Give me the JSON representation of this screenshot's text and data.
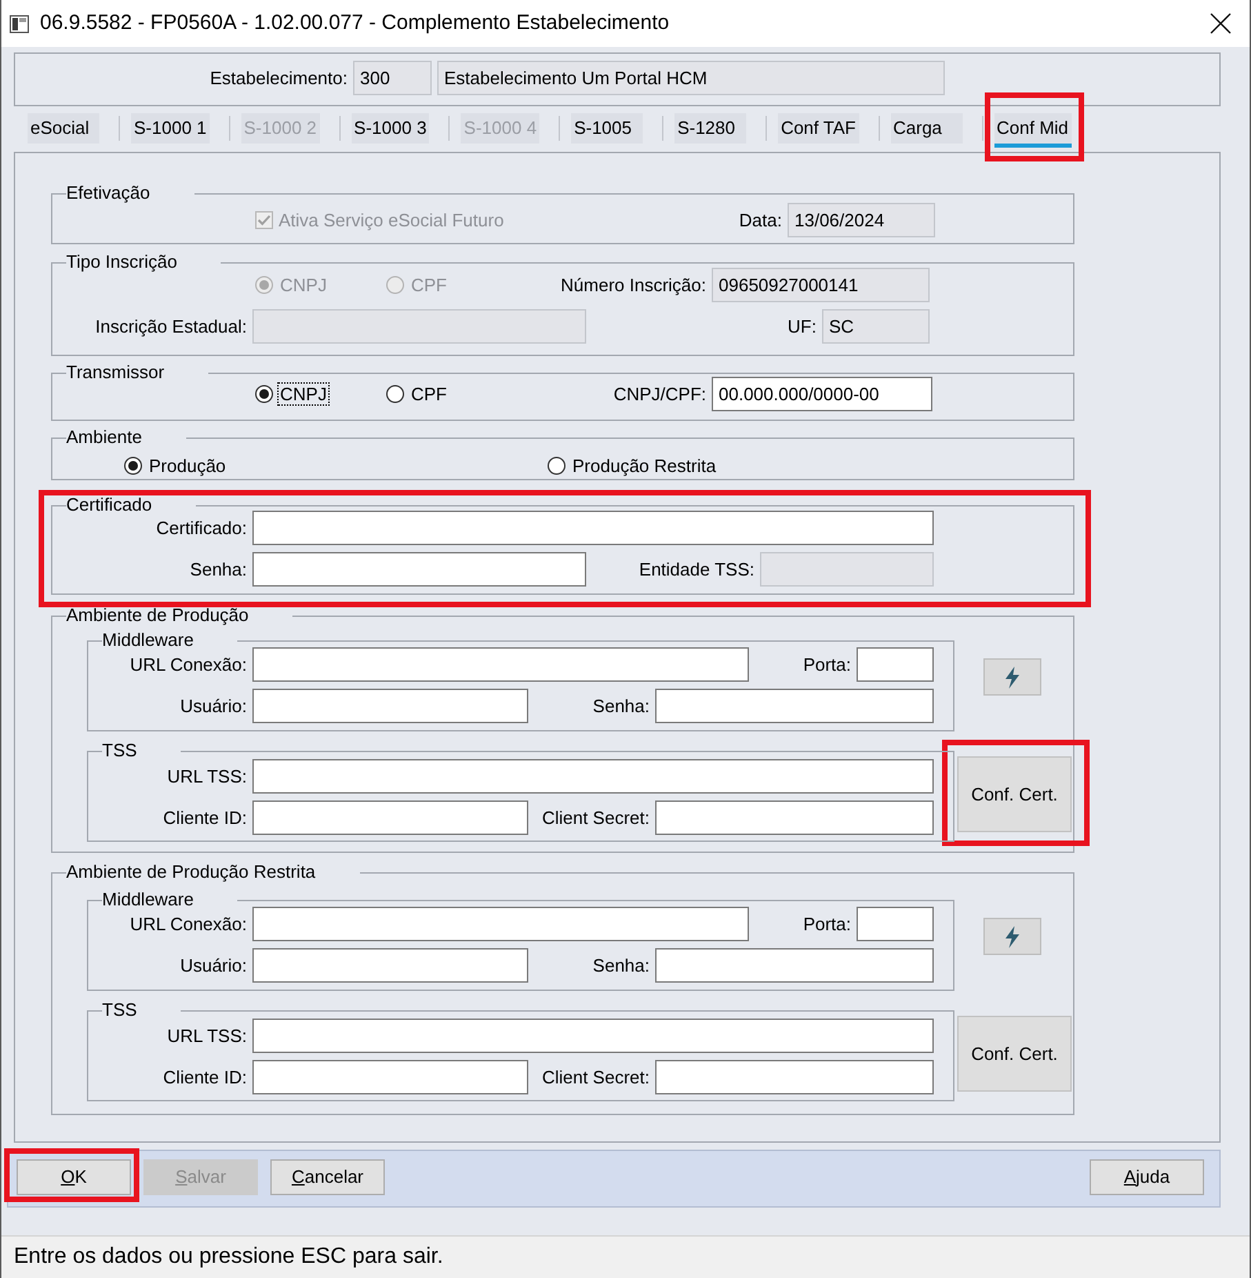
{
  "window": {
    "title": "06.9.5582 - FP0560A - 1.02.00.077 - Complemento Estabelecimento"
  },
  "header": {
    "label": "Estabelecimento:",
    "code": "300",
    "name": "Estabelecimento Um Portal HCM"
  },
  "tabs": [
    {
      "label": "eSocial",
      "selected": false,
      "disabled": false,
      "highlighted": false
    },
    {
      "label": "S-1000 1",
      "selected": false,
      "disabled": false,
      "highlighted": false
    },
    {
      "label": "S-1000 2",
      "selected": false,
      "disabled": true,
      "highlighted": false
    },
    {
      "label": "S-1000 3",
      "selected": false,
      "disabled": false,
      "highlighted": false
    },
    {
      "label": "S-1000 4",
      "selected": false,
      "disabled": true,
      "highlighted": false
    },
    {
      "label": "S-1005",
      "selected": false,
      "disabled": false,
      "highlighted": false
    },
    {
      "label": "S-1280",
      "selected": false,
      "disabled": false,
      "highlighted": false
    },
    {
      "label": "Conf TAF",
      "selected": false,
      "disabled": false,
      "highlighted": false
    },
    {
      "label": "Carga",
      "selected": false,
      "disabled": false,
      "highlighted": false
    },
    {
      "label": "Conf Mid",
      "selected": true,
      "disabled": false,
      "highlighted": true
    }
  ],
  "efetivacao": {
    "title": "Efetivação",
    "checkbox": {
      "label": "Ativa Serviço eSocial Futuro",
      "checked": true,
      "disabled": true
    },
    "date": {
      "label": "Data:",
      "value": "13/06/2024",
      "disabled": true
    }
  },
  "tipo_inscricao": {
    "title": "Tipo Inscrição",
    "options": [
      {
        "label": "CNPJ",
        "selected": true,
        "disabled": true
      },
      {
        "label": "CPF",
        "selected": false,
        "disabled": true
      }
    ],
    "numero_inscricao": {
      "label": "Número Inscrição:",
      "value": "09650927000141",
      "disabled": true
    },
    "inscricao_estadual": {
      "label": "Inscrição Estadual:",
      "disabled": true
    },
    "uf": {
      "label": "UF:",
      "value": "SC",
      "disabled": true
    }
  },
  "transmissor": {
    "title": "Transmissor",
    "options": [
      {
        "label": "CNPJ",
        "selected": true,
        "focused": true
      },
      {
        "label": "CPF",
        "selected": false,
        "focused": false
      }
    ],
    "cnpj_cpf": {
      "label": "CNPJ/CPF:",
      "value": "00.000.000/0000-00",
      "disabled": false
    }
  },
  "ambiente": {
    "title": "Ambiente",
    "options": [
      {
        "label": "Produção",
        "selected": true
      },
      {
        "label": "Produção Restrita",
        "selected": false
      }
    ]
  },
  "certificado": {
    "title": "Certificado",
    "highlighted": true,
    "certificado": {
      "label": "Certificado:",
      "disabled": false
    },
    "senha": {
      "label": "Senha:",
      "disabled": false
    },
    "entidade_tss": {
      "label": "Entidade TSS:",
      "disabled": true
    }
  },
  "environments": [
    {
      "title": "Ambiente de Produção",
      "middleware": {
        "title": "Middleware",
        "url": {
          "label": "URL Conexão:"
        },
        "porta": {
          "label": "Porta:"
        },
        "usuario": {
          "label": "Usuário:"
        },
        "senha": {
          "label": "Senha:"
        }
      },
      "tss": {
        "title": "TSS",
        "url": {
          "label": "URL TSS:"
        },
        "client_id": {
          "label": "Cliente ID:"
        },
        "client_secret": {
          "label": "Client Secret:"
        }
      },
      "cert_button": {
        "label": "Conf. Cert.",
        "highlighted": true
      }
    },
    {
      "title": "Ambiente de Produção Restrita",
      "middleware": {
        "title": "Middleware",
        "url": {
          "label": "URL Conexão:"
        },
        "porta": {
          "label": "Porta:"
        },
        "usuario": {
          "label": "Usuário:"
        },
        "senha": {
          "label": "Senha:"
        }
      },
      "tss": {
        "title": "TSS",
        "url": {
          "label": "URL TSS:"
        },
        "client_id": {
          "label": "Cliente ID:"
        },
        "client_secret": {
          "label": "Client Secret:"
        }
      },
      "cert_button": {
        "label": "Conf. Cert.",
        "highlighted": false
      }
    }
  ],
  "buttons": [
    {
      "label": "OK",
      "disabled": false,
      "highlighted": true,
      "mnemonic": true
    },
    {
      "label": "Salvar",
      "disabled": true,
      "highlighted": false,
      "mnemonic": true
    },
    {
      "label": "Cancelar",
      "disabled": false,
      "highlighted": false,
      "mnemonic": true
    }
  ],
  "help_button": {
    "label": "Ajuda",
    "mnemonic": true
  },
  "status_bar": {
    "text": "Entre os dados ou pressione ESC para sair."
  }
}
